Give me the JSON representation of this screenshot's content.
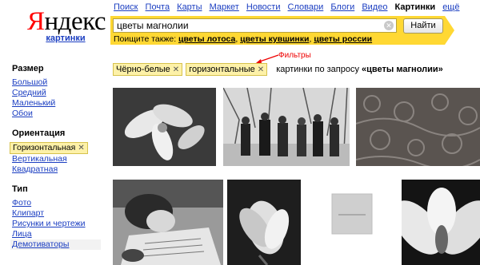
{
  "logo": {
    "main_first": "Я",
    "main_rest": "ндекс",
    "sub": "картинки"
  },
  "services": [
    {
      "label": "Поиск"
    },
    {
      "label": "Почта"
    },
    {
      "label": "Карты"
    },
    {
      "label": "Маркет"
    },
    {
      "label": "Новости"
    },
    {
      "label": "Словари"
    },
    {
      "label": "Блоги"
    },
    {
      "label": "Видео"
    },
    {
      "label": "Картинки",
      "active": true
    },
    {
      "label": "ещё"
    }
  ],
  "search": {
    "value": "цветы магнолии",
    "button_label": "Найти"
  },
  "suggest": {
    "prefix": "Поищите также: ",
    "links": [
      "цветы лотоса",
      "цветы кувшинки",
      "цветы россии"
    ]
  },
  "filters": {
    "chips": [
      "Чёрно-белые",
      "горизонтальные"
    ],
    "query_prefix": "картинки по запросу ",
    "query": "«цветы магнолии»",
    "annotation": "Фильтры"
  },
  "sidebar": {
    "size": {
      "title": "Размер",
      "items": [
        "Большой",
        "Средний",
        "Маленький",
        "Обои"
      ]
    },
    "orientation": {
      "title": "Ориентация",
      "active": "Горизонтальная",
      "items": [
        "Вертикальная",
        "Квадратная"
      ]
    },
    "type": {
      "title": "Тип",
      "items": [
        "Фото",
        "Клипарт",
        "Рисунки и чертежи",
        "Лица",
        "Демотиваторы"
      ]
    }
  },
  "colors": {
    "accent_yellow": "#ffd833",
    "link_blue": "#1a3dc1",
    "logo_red": "#ff0000",
    "chip_bg": "#fdf1a8"
  }
}
